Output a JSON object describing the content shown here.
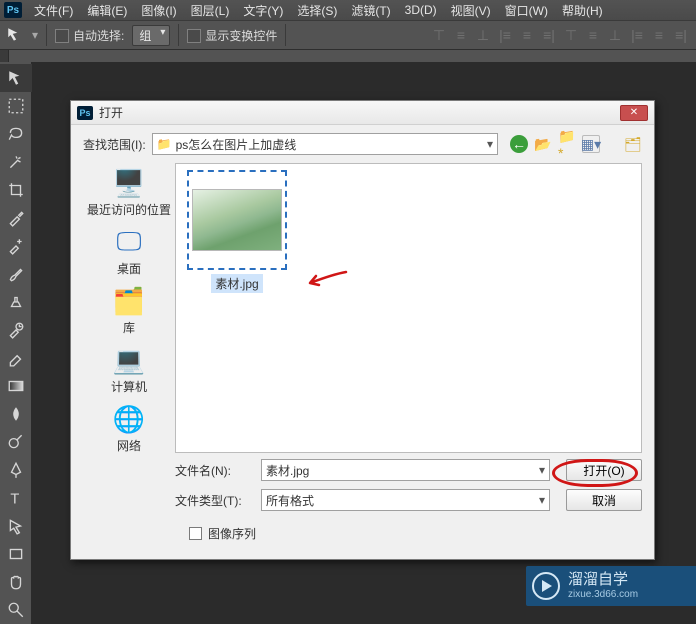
{
  "menu": {
    "file": "文件(F)",
    "edit": "编辑(E)",
    "image": "图像(I)",
    "layer": "图层(L)",
    "text": "文字(Y)",
    "select": "选择(S)",
    "filter": "滤镜(T)",
    "threeD": "3D(D)",
    "view": "视图(V)",
    "window": "窗口(W)",
    "help": "帮助(H)"
  },
  "optbar": {
    "autoselect": "自动选择:",
    "group": "组",
    "showTransform": "显示变换控件"
  },
  "dialog": {
    "title": "打开",
    "lookin_label": "查找范围(I):",
    "folder": "ps怎么在图片上加虚线",
    "places": {
      "recent": "最近访问的位置",
      "desktop": "桌面",
      "library": "库",
      "computer": "计算机",
      "network": "网络"
    },
    "file_item": "素材.jpg",
    "filename_label": "文件名(N):",
    "filename_value": "素材.jpg",
    "filetype_label": "文件类型(T):",
    "filetype_value": "所有格式",
    "open_btn": "打开(O)",
    "cancel_btn": "取消",
    "sequence": "图像序列"
  },
  "watermark": {
    "cn": "溜溜自学",
    "url": "zixue.3d66.com"
  }
}
